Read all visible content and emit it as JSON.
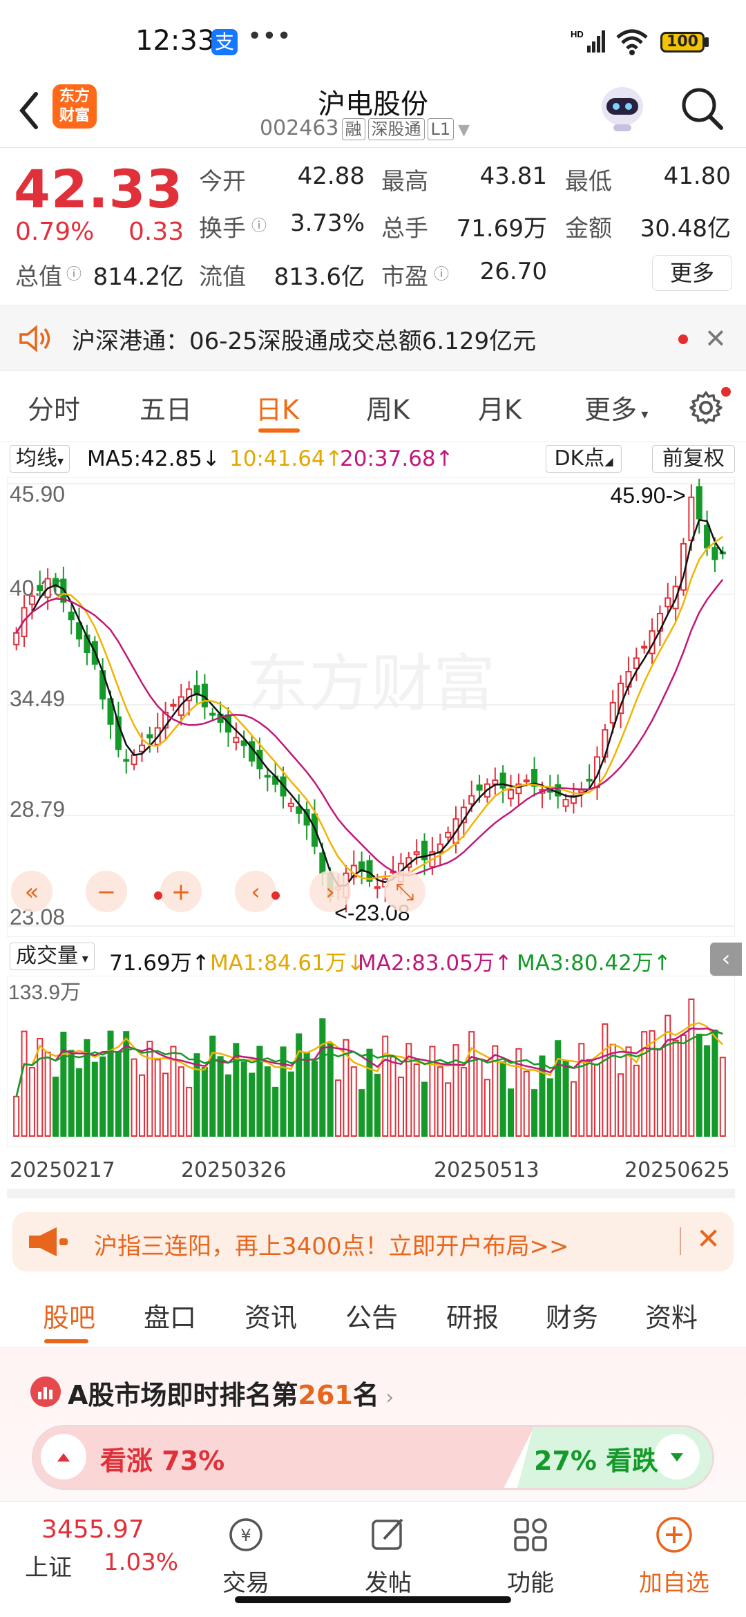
{
  "status_bar": {
    "time": "12:33",
    "app_badge": "支",
    "more": "•••",
    "battery": "100"
  },
  "header": {
    "stock_name": "沪电股份",
    "stock_code": "002463",
    "tags": [
      "融",
      "深股通",
      "L1"
    ],
    "logo_text": "东方财富"
  },
  "quote": {
    "price": "42.33",
    "change_pct": "0.79%",
    "change": "0.33",
    "fields": [
      {
        "label": "今开",
        "value": "42.88",
        "color": "#e0303a"
      },
      {
        "label": "最高",
        "value": "43.81",
        "color": "#e0303a"
      },
      {
        "label": "最低",
        "value": "41.80",
        "color": "#159a2a"
      },
      {
        "label": "换手",
        "value": "3.73%",
        "color": "#222"
      },
      {
        "label": "总手",
        "value": "71.69万",
        "color": "#222"
      },
      {
        "label": "金额",
        "value": "30.48亿",
        "color": "#222"
      },
      {
        "label": "总值",
        "value": "814.2亿",
        "color": "#222"
      },
      {
        "label": "流值",
        "value": "813.6亿",
        "color": "#222"
      },
      {
        "label": "市盈",
        "value": "26.70",
        "color": "#222"
      }
    ],
    "more_label": "更多"
  },
  "news": {
    "text": "沪深港通：06-25深股通成交总额6.129亿元"
  },
  "period_tabs": [
    "分时",
    "五日",
    "日K",
    "周K",
    "月K",
    "更多"
  ],
  "ma_row": {
    "selector": "均线",
    "ma5": "MA5:42.85",
    "ma10": "10:41.64",
    "ma20": "20:37.68",
    "dk": "DK点",
    "fq": "前复权"
  },
  "chart_labels": {
    "y_top": "45.90",
    "y2": "40.20",
    "y3": "34.49",
    "y4": "28.79",
    "y_bottom": "23.08",
    "max_note": "45.90->",
    "min_note": "<-23.08"
  },
  "volume_row": {
    "selector": "成交量",
    "vol": "71.69万",
    "ma1": "MA1:84.61万",
    "ma2": "MA2:83.05万",
    "ma3": "MA3:80.42万",
    "vmax": "133.9万"
  },
  "dates": [
    "20250217",
    "20250326",
    "20250513",
    "20250625"
  ],
  "promo": {
    "text": "沪指三连阳，再上3400点！立即开户布局>>"
  },
  "info_tabs": [
    "股吧",
    "盘口",
    "资讯",
    "公告",
    "研报",
    "财务",
    "资料"
  ],
  "rank": {
    "prefix": "A股市场即时排名第",
    "number": "261",
    "suffix": "名"
  },
  "sentiment": {
    "up_label": "看涨 73%",
    "down_label": "27% 看跌",
    "up_fraction": 0.73
  },
  "bottom_nav": {
    "index_value": "3455.97",
    "index_name": "上证",
    "index_pct": "1.03%",
    "items": [
      "交易",
      "发帖",
      "功能",
      "加自选"
    ]
  },
  "colors": {
    "up": "#e0303a",
    "down": "#159a2a",
    "accent": "#f06a14",
    "ma5": "#111111",
    "ma10": "#f0b400",
    "ma20": "#c0187a"
  },
  "chart_data": {
    "type": "candlestick",
    "y_ticks": [
      45.9,
      40.2,
      34.49,
      28.79,
      23.08
    ],
    "ylim": [
      23.08,
      45.9
    ],
    "x_ticks": [
      "20250217",
      "20250326",
      "20250513",
      "20250625"
    ],
    "max": 45.9,
    "min": 23.08,
    "close_series": [
      38.2,
      39.5,
      40.1,
      40.4,
      41.0,
      40.6,
      39.8,
      38.9,
      37.9,
      37.2,
      36.6,
      34.8,
      33.5,
      32.2,
      31.6,
      31.9,
      32.4,
      32.8,
      33.3,
      34.1,
      34.5,
      34.9,
      35.3,
      35.0,
      34.4,
      34.0,
      33.6,
      33.1,
      32.8,
      32.4,
      31.6,
      31.2,
      30.8,
      30.4,
      29.8,
      29.4,
      28.9,
      28.3,
      27.2,
      25.8,
      24.6,
      25.1,
      25.8,
      26.2,
      25.9,
      25.4,
      25.1,
      25.5,
      25.9,
      26.3,
      26.6,
      26.9,
      26.5,
      26.9,
      27.3,
      27.9,
      28.6,
      29.2,
      29.8,
      30.1,
      30.4,
      30.6,
      30.2,
      30.1,
      30.4,
      30.6,
      30.3,
      30.1,
      30.0,
      29.8,
      29.6,
      29.8,
      30.1,
      30.6,
      31.8,
      33.2,
      34.6,
      35.6,
      36.2,
      36.9,
      37.5,
      38.3,
      39.2,
      40.0,
      40.6,
      42.8,
      45.2,
      44.1,
      42.6,
      42.0,
      42.3
    ]
  }
}
